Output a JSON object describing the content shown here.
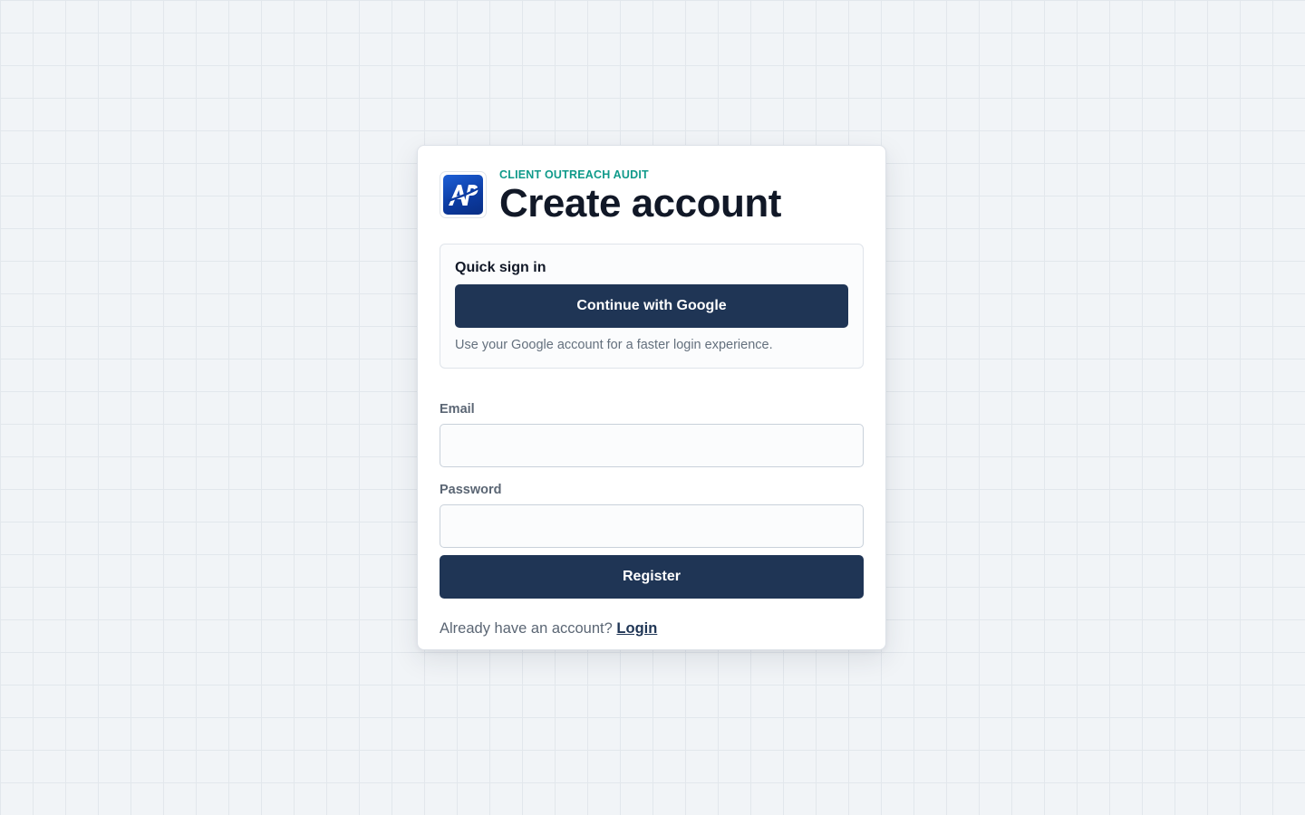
{
  "app": {
    "kicker": "CLIENT OUTREACH AUDIT",
    "logo_text": "AP",
    "logo_icon": "ap-logo-icon"
  },
  "page": {
    "title": "Create account"
  },
  "quick_sign_in": {
    "heading": "Quick sign in",
    "google_button_label": "Continue with Google",
    "hint": "Use your Google account for a faster login experience."
  },
  "form": {
    "email_label": "Email",
    "email_value": "",
    "password_label": "Password",
    "password_value": "",
    "register_label": "Register"
  },
  "footer": {
    "prompt": "Already have an account?",
    "login_label": "Login"
  },
  "colors": {
    "accent": "#0f9a8a",
    "primary_button": "#1f3555",
    "logo_blue": "#0b3aa0"
  }
}
